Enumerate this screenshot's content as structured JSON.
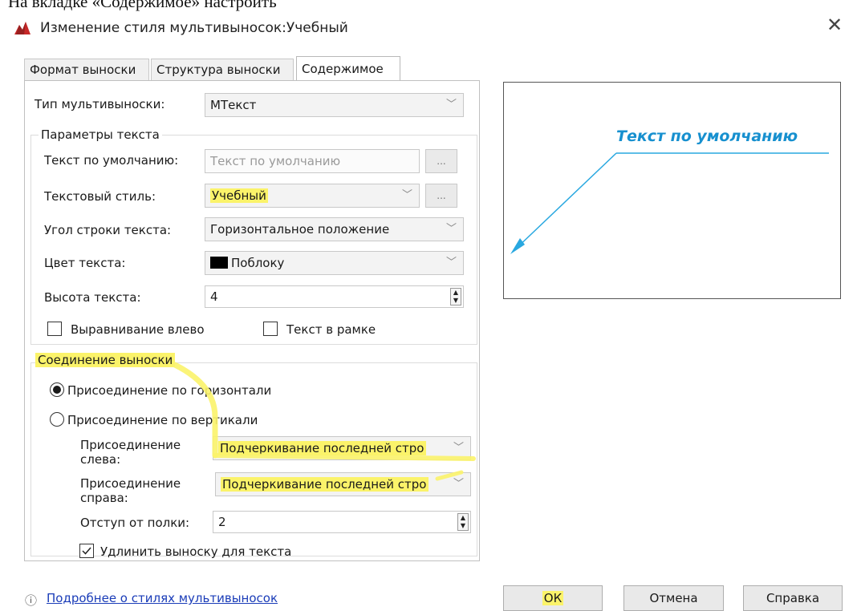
{
  "caption": "На вкладке «Содержимое» настроить",
  "window": {
    "title": "Изменение стиля мультивыносок:Учебный",
    "close_icon": "close-icon"
  },
  "tabs": [
    {
      "label": "Формат выноски",
      "active": false
    },
    {
      "label": "Структура выноски",
      "active": false
    },
    {
      "label": "Содержимое",
      "active": true
    }
  ],
  "content": {
    "multileader_type_label": "Тип мультивыноски:",
    "multileader_type_value": "МТекст",
    "text_params": {
      "title": "Параметры текста",
      "default_text_label": "Текст по умолчанию:",
      "default_text_value": "Текст по умолчанию",
      "browse_label": "...",
      "text_style_label": "Текстовый стиль:",
      "text_style_value": "Учебный",
      "text_angle_label": "Угол строки текста:",
      "text_angle_value": "Горизонтальное положение",
      "text_color_label": "Цвет текста:",
      "text_color_value": "Поблоку",
      "text_height_label": "Высота текста:",
      "text_height_value": "4",
      "left_align_label": "Выравнивание влево",
      "left_align_checked": false,
      "frame_label": "Текст в рамке",
      "frame_checked": false
    },
    "leader_connection": {
      "title": "Соединение выноски",
      "horizontal_label": "Присоединение по горизонтали",
      "horizontal_selected": true,
      "vertical_label": "Присоединение по вертикали",
      "vertical_selected": false,
      "attach_left_label": "Присоединение слева:",
      "attach_left_value": "Подчеркивание последней стро",
      "attach_right_label": "Присоединение справа:",
      "attach_right_value": "Подчеркивание последней стро",
      "landing_gap_label": "Отступ от полки:",
      "landing_gap_value": "2",
      "extend_label": "Удлинить выноску для текста",
      "extend_checked": true
    }
  },
  "preview": {
    "text": "Текст по умолчанию",
    "line_color": "#29a8e0",
    "text_color": "#1790cf"
  },
  "footer": {
    "info_icon": "info-icon",
    "link": "Подробнее о стилях мультивыносок",
    "ok": "ОК",
    "cancel": "Отмена",
    "help": "Справка"
  },
  "colors": {
    "highlight": "#fbf36a",
    "link": "#1a3cb8"
  }
}
